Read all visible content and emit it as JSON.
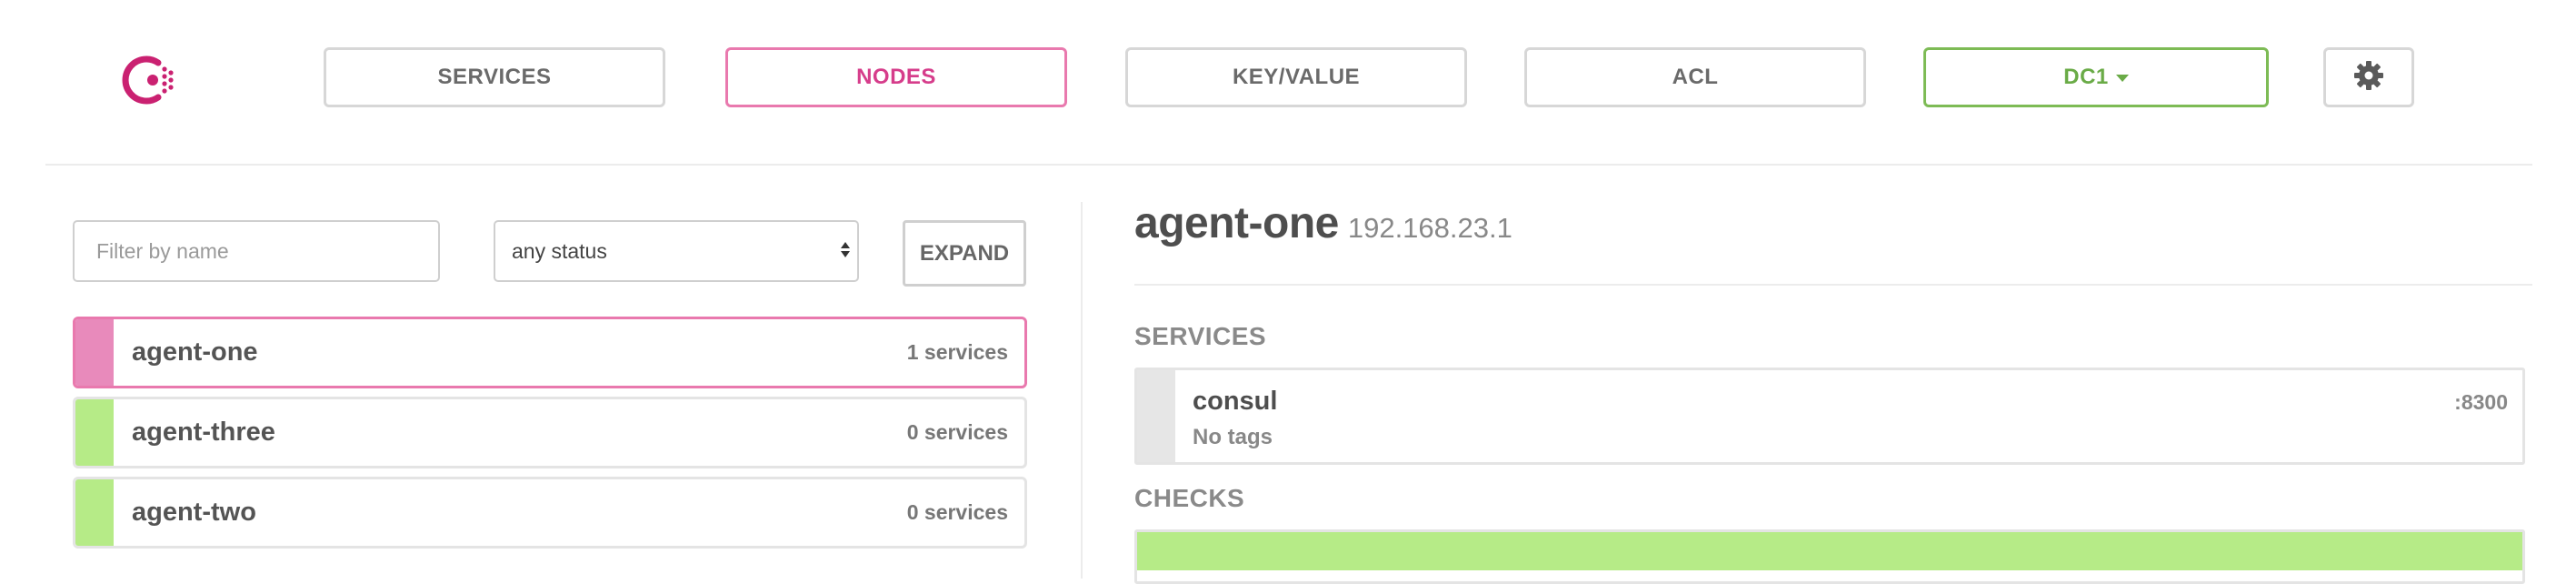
{
  "nav": {
    "items": [
      {
        "label": "SERVICES",
        "active": false
      },
      {
        "label": "NODES",
        "active": true
      },
      {
        "label": "KEY/VALUE",
        "active": false
      },
      {
        "label": "ACL",
        "active": false
      }
    ],
    "datacenter": "DC1"
  },
  "filters": {
    "name_placeholder": "Filter by name",
    "name_value": "",
    "status_selected": "any status",
    "expand_label": "EXPAND"
  },
  "nodes": [
    {
      "name": "agent-one",
      "services": "1 services",
      "status": "selected"
    },
    {
      "name": "agent-three",
      "services": "0 services",
      "status": "passing"
    },
    {
      "name": "agent-two",
      "services": "0 services",
      "status": "passing"
    }
  ],
  "detail": {
    "name": "agent-one",
    "address": "192.168.23.1",
    "services_heading": "SERVICES",
    "services": [
      {
        "name": "consul",
        "tags": "No tags",
        "port": ":8300"
      }
    ],
    "checks_heading": "CHECKS"
  },
  "colors": {
    "brand": "#ca2171",
    "active_pink": "#e979ae",
    "datacenter_green": "#7dbb55",
    "passing_green": "#b6eb87",
    "node_selected_bar": "#e88abb",
    "border_gray": "#d7d7d7"
  },
  "icons": {
    "logo": "consul-logo-icon",
    "settings": "gear-icon",
    "dropdown": "caret-down-icon"
  }
}
